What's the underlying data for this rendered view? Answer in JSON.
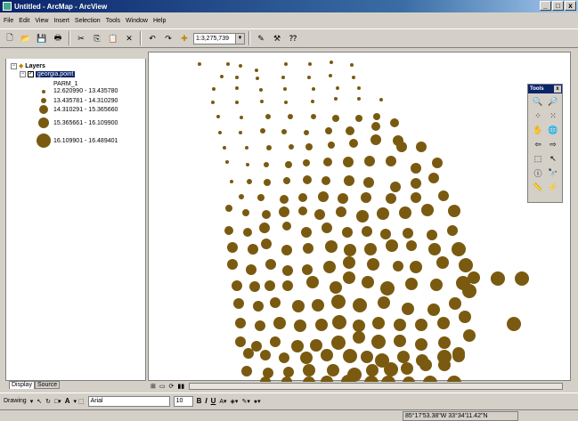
{
  "window": {
    "title": "Untitled - ArcMap - ArcView",
    "min": "_",
    "max": "□",
    "close": "x"
  },
  "menu": [
    "File",
    "Edit",
    "View",
    "Insert",
    "Selection",
    "Tools",
    "Window",
    "Help"
  ],
  "toolbar": {
    "scale": "1:3,275,739"
  },
  "toc": {
    "root": "Layers",
    "layer": "georgia.point",
    "field": "PARM_1",
    "classes": [
      {
        "label": "12.620990 - 13.435780",
        "size": 4
      },
      {
        "label": "13.435781 - 14.310290",
        "size": 6
      },
      {
        "label": "14.310291 - 15.365660",
        "size": 10
      },
      {
        "label": "15.365661 - 16.109900",
        "size": 12
      },
      {
        "label": "16.109901 - 16.489401",
        "size": 16
      }
    ],
    "tabs": [
      "Display",
      "Source"
    ]
  },
  "tools": {
    "title": "Tools"
  },
  "drawing": {
    "label": "Drawing",
    "font": "Arial",
    "size": "10",
    "bold": "B",
    "italic": "I",
    "underline": "U",
    "text_tool": "A"
  },
  "status": {
    "coords": "85°17'53.38\"W  33°34'11.42\"N"
  },
  "colors": {
    "point": "#7a5a10",
    "selection": "#0a246a"
  },
  "map_points": [
    [
      57,
      13,
      2
    ],
    [
      89,
      13,
      2
    ],
    [
      103,
      15,
      2
    ],
    [
      121,
      20,
      2
    ],
    [
      154,
      13,
      2
    ],
    [
      181,
      13,
      2
    ],
    [
      205,
      11,
      2
    ],
    [
      228,
      14,
      2
    ],
    [
      82,
      27,
      2
    ],
    [
      99,
      28,
      2
    ],
    [
      122,
      29,
      2
    ],
    [
      151,
      28,
      2
    ],
    [
      180,
      28,
      2
    ],
    [
      204,
      26,
      2
    ],
    [
      230,
      28,
      2
    ],
    [
      73,
      41,
      2
    ],
    [
      99,
      40,
      2
    ],
    [
      126,
      42,
      2
    ],
    [
      153,
      41,
      2
    ],
    [
      185,
      41,
      2
    ],
    [
      212,
      40,
      2
    ],
    [
      236,
      40,
      2
    ],
    [
      72,
      56,
      2
    ],
    [
      99,
      56,
      2
    ],
    [
      127,
      55,
      2
    ],
    [
      154,
      56,
      2
    ],
    [
      184,
      55,
      2
    ],
    [
      210,
      52,
      2
    ],
    [
      236,
      52,
      2
    ],
    [
      261,
      53,
      2
    ],
    [
      78,
      72,
      2
    ],
    [
      104,
      73,
      2
    ],
    [
      134,
      72,
      3
    ],
    [
      159,
      72,
      3
    ],
    [
      185,
      72,
      3
    ],
    [
      210,
      74,
      4
    ],
    [
      236,
      74,
      4
    ],
    [
      256,
      72,
      4
    ],
    [
      276,
      79,
      5
    ],
    [
      80,
      90,
      2
    ],
    [
      103,
      90,
      2
    ],
    [
      128,
      88,
      3
    ],
    [
      152,
      89,
      3
    ],
    [
      177,
      90,
      3
    ],
    [
      202,
      88,
      4
    ],
    [
      226,
      88,
      5
    ],
    [
      255,
      83,
      5
    ],
    [
      280,
      99,
      6
    ],
    [
      85,
      107,
      2
    ],
    [
      110,
      107,
      2
    ],
    [
      135,
      107,
      3
    ],
    [
      160,
      106,
      3
    ],
    [
      180,
      106,
      4
    ],
    [
      205,
      104,
      4
    ],
    [
      230,
      102,
      5
    ],
    [
      255,
      98,
      6
    ],
    [
      284,
      106,
      6
    ],
    [
      306,
      106,
      6
    ],
    [
      88,
      123,
      2
    ],
    [
      111,
      126,
      2
    ],
    [
      132,
      126,
      3
    ],
    [
      157,
      126,
      4
    ],
    [
      177,
      124,
      4
    ],
    [
      201,
      123,
      5
    ],
    [
      224,
      123,
      6
    ],
    [
      248,
      122,
      6
    ],
    [
      272,
      122,
      6
    ],
    [
      300,
      130,
      6
    ],
    [
      324,
      124,
      6
    ],
    [
      93,
      145,
      2
    ],
    [
      113,
      145,
      3
    ],
    [
      133,
      146,
      4
    ],
    [
      155,
      144,
      4
    ],
    [
      178,
      143,
      5
    ],
    [
      199,
      144,
      5
    ],
    [
      225,
      144,
      6
    ],
    [
      247,
      146,
      6
    ],
    [
      277,
      151,
      6
    ],
    [
      300,
      147,
      6
    ],
    [
      320,
      141,
      6
    ],
    [
      104,
      162,
      3
    ],
    [
      126,
      163,
      4
    ],
    [
      152,
      165,
      5
    ],
    [
      173,
      163,
      5
    ],
    [
      196,
      162,
      6
    ],
    [
      218,
      164,
      6
    ],
    [
      244,
      163,
      6
    ],
    [
      272,
      164,
      6
    ],
    [
      300,
      163,
      6
    ],
    [
      331,
      161,
      6
    ],
    [
      90,
      175,
      4
    ],
    [
      109,
      180,
      4
    ],
    [
      132,
      182,
      5
    ],
    [
      152,
      179,
      6
    ],
    [
      173,
      178,
      5
    ],
    [
      192,
      182,
      6
    ],
    [
      216,
      179,
      6
    ],
    [
      240,
      184,
      7
    ],
    [
      263,
      181,
      7
    ],
    [
      288,
      180,
      7
    ],
    [
      313,
      177,
      7
    ],
    [
      343,
      178,
      7
    ],
    [
      90,
      200,
      5
    ],
    [
      111,
      202,
      5
    ],
    [
      130,
      197,
      6
    ],
    [
      155,
      195,
      5
    ],
    [
      177,
      202,
      6
    ],
    [
      200,
      197,
      6
    ],
    [
      223,
      202,
      6
    ],
    [
      245,
      201,
      6
    ],
    [
      266,
      204,
      6
    ],
    [
      291,
      203,
      6
    ],
    [
      318,
      205,
      6
    ],
    [
      341,
      200,
      6
    ],
    [
      94,
      219,
      6
    ],
    [
      117,
      221,
      6
    ],
    [
      132,
      215,
      6
    ],
    [
      155,
      222,
      6
    ],
    [
      179,
      220,
      6
    ],
    [
      205,
      218,
      7
    ],
    [
      226,
      222,
      7
    ],
    [
      249,
      221,
      7
    ],
    [
      273,
      217,
      7
    ],
    [
      295,
      217,
      6
    ],
    [
      321,
      221,
      7
    ],
    [
      348,
      221,
      8
    ],
    [
      94,
      238,
      6
    ],
    [
      115,
      244,
      6
    ],
    [
      137,
      238,
      6
    ],
    [
      156,
      245,
      6
    ],
    [
      178,
      244,
      6
    ],
    [
      203,
      241,
      7
    ],
    [
      225,
      236,
      7
    ],
    [
      252,
      238,
      7
    ],
    [
      280,
      240,
      6
    ],
    [
      300,
      241,
      7
    ],
    [
      330,
      236,
      7
    ],
    [
      356,
      239,
      8
    ],
    [
      365,
      253,
      7
    ],
    [
      391,
      254,
      7
    ],
    [
      99,
      262,
      6
    ],
    [
      119,
      263,
      6
    ],
    [
      136,
      262,
      6
    ],
    [
      156,
      262,
      6
    ],
    [
      184,
      258,
      7
    ],
    [
      210,
      264,
      7
    ],
    [
      225,
      253,
      7
    ],
    [
      246,
      258,
      7
    ],
    [
      268,
      265,
      8
    ],
    [
      295,
      260,
      7
    ],
    [
      323,
      261,
      7
    ],
    [
      353,
      259,
      8
    ],
    [
      392,
      254,
      8
    ],
    [
      101,
      282,
      6
    ],
    [
      123,
      285,
      6
    ],
    [
      142,
      281,
      6
    ],
    [
      168,
      285,
      7
    ],
    [
      190,
      284,
      7
    ],
    [
      213,
      280,
      8
    ],
    [
      237,
      284,
      8
    ],
    [
      264,
      281,
      7
    ],
    [
      291,
      288,
      7
    ],
    [
      320,
      289,
      7
    ],
    [
      344,
      282,
      7
    ],
    [
      360,
      268,
      8
    ],
    [
      103,
      304,
      6
    ],
    [
      125,
      307,
      6
    ],
    [
      147,
      304,
      7
    ],
    [
      170,
      307,
      7
    ],
    [
      194,
      306,
      7
    ],
    [
      214,
      303,
      8
    ],
    [
      236,
      307,
      7
    ],
    [
      258,
      304,
      7
    ],
    [
      282,
      306,
      7
    ],
    [
      306,
      306,
      7
    ],
    [
      331,
      304,
      7
    ],
    [
      355,
      297,
      7
    ],
    [
      103,
      325,
      6
    ],
    [
      121,
      330,
      6
    ],
    [
      142,
      325,
      6
    ],
    [
      167,
      330,
      7
    ],
    [
      188,
      329,
      7
    ],
    [
      213,
      326,
      8
    ],
    [
      236,
      320,
      7
    ],
    [
      258,
      325,
      8
    ],
    [
      282,
      324,
      7
    ],
    [
      306,
      328,
      7
    ],
    [
      332,
      326,
      7
    ],
    [
      360,
      318,
      7
    ],
    [
      112,
      338,
      6
    ],
    [
      131,
      340,
      6
    ],
    [
      152,
      343,
      6
    ],
    [
      177,
      343,
      7
    ],
    [
      200,
      340,
      7
    ],
    [
      226,
      341,
      8
    ],
    [
      245,
      342,
      7
    ],
    [
      262,
      346,
      8
    ],
    [
      286,
      342,
      7
    ],
    [
      307,
      346,
      7
    ],
    [
      332,
      342,
      8
    ],
    [
      348,
      338,
      7
    ],
    [
      110,
      358,
      6
    ],
    [
      134,
      360,
      6
    ],
    [
      157,
      359,
      6
    ],
    [
      180,
      357,
      7
    ],
    [
      207,
      357,
      7
    ],
    [
      231,
      362,
      8
    ],
    [
      251,
      357,
      7
    ],
    [
      272,
      356,
      8
    ],
    [
      290,
      355,
      7
    ],
    [
      311,
      351,
      7
    ],
    [
      332,
      351,
      7
    ],
    [
      348,
      341,
      7
    ],
    [
      131,
      370,
      6
    ],
    [
      155,
      370,
      6
    ],
    [
      180,
      371,
      7
    ],
    [
      200,
      370,
      7
    ],
    [
      224,
      370,
      8
    ],
    [
      250,
      371,
      8
    ],
    [
      269,
      371,
      8
    ],
    [
      292,
      371,
      7
    ],
    [
      316,
      371,
      8
    ],
    [
      343,
      371,
      8
    ],
    [
      109,
      383,
      6
    ],
    [
      136,
      387,
      6
    ],
    [
      162,
      386,
      7
    ],
    [
      183,
      385,
      7
    ],
    [
      210,
      386,
      7
    ],
    [
      235,
      389,
      7
    ],
    [
      262,
      385,
      8
    ],
    [
      288,
      386,
      8
    ],
    [
      311,
      388,
      8
    ],
    [
      333,
      393,
      8
    ],
    [
      358,
      382,
      8
    ],
    [
      116,
      398,
      6
    ],
    [
      144,
      396,
      6
    ],
    [
      171,
      400,
      7
    ],
    [
      199,
      397,
      7
    ],
    [
      225,
      397,
      8
    ],
    [
      250,
      400,
      8
    ],
    [
      271,
      413,
      8
    ],
    [
      290,
      396,
      8
    ],
    [
      318,
      404,
      8
    ],
    [
      343,
      395,
      8
    ],
    [
      378,
      393,
      8
    ],
    [
      419,
      254,
      8
    ],
    [
      410,
      305,
      8
    ]
  ]
}
